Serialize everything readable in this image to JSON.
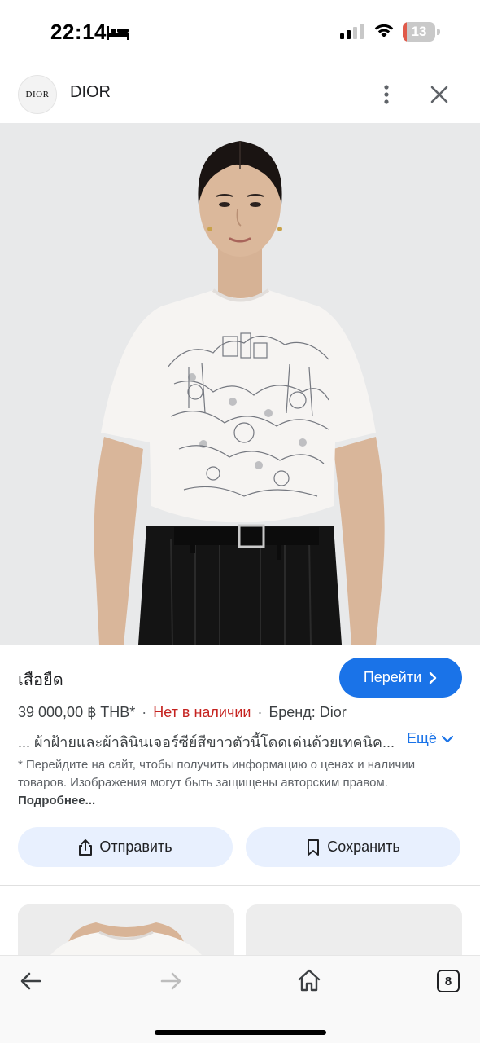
{
  "status_bar": {
    "time": "22:14",
    "battery_level": "13",
    "battery_fraction": 0.13,
    "icons": [
      "bed-icon",
      "signal-icon",
      "wifi-icon",
      "battery-icon"
    ]
  },
  "header": {
    "logo_text": "DIOR",
    "site_name": "DIOR"
  },
  "product": {
    "title": "เสือยืด",
    "goto_label": "Перейти",
    "price": "39 000,00 ฿ THB*",
    "stock": "Нет в наличии",
    "brand": "Бренд: Dior",
    "description": "... ผ้าฝ้ายและผ้าลินินเจอร์ซีย์สีขาวตัวนี้โดดเด่นด้วยเทคนิค...",
    "more_label": "Ещё",
    "disclaimer": "* Перейдите на сайт, чтобы получить информацию о ценах и наличии товаров. Изображения могут быть защищены авторским правом.",
    "disclaimer_link": "Подробнее..."
  },
  "actions": {
    "share_label": "Отправить",
    "save_label": "Сохранить"
  },
  "bottom_bar": {
    "tab_count": "8"
  },
  "colors": {
    "accent": "#1a73e8",
    "stock_red": "#c5221f",
    "action_bg": "#e8f0fe",
    "battery_low": "#e05a4a"
  }
}
